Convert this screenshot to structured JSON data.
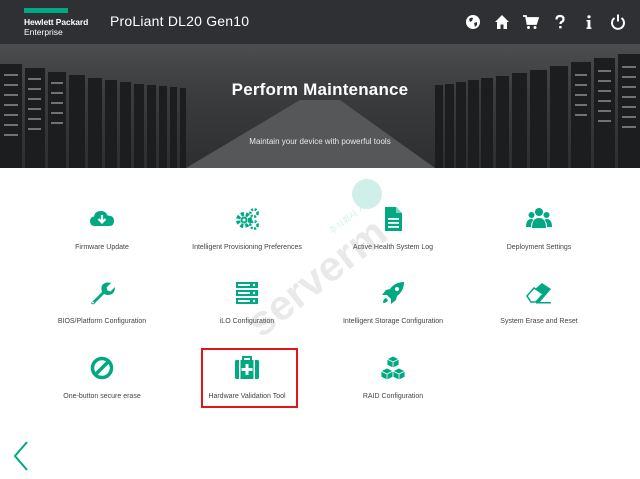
{
  "header": {
    "logo_line1": "Hewlett Packard",
    "logo_line2": "Enterprise",
    "product_title": "ProLiant DL20 Gen10",
    "icons": [
      "globe-icon",
      "home-icon",
      "cart-icon",
      "help-icon",
      "info-icon",
      "power-icon"
    ]
  },
  "hero": {
    "title": "Perform Maintenance",
    "subtitle": "Maintain your device with powerful tools"
  },
  "tiles": [
    {
      "label": "Firmware Update",
      "icon": "cloud-download-icon"
    },
    {
      "label": "Intelligent Provisioning Preferences",
      "icon": "gears-icon"
    },
    {
      "label": "Active Health System Log",
      "icon": "document-icon"
    },
    {
      "label": "Deployment Settings",
      "icon": "users-icon"
    },
    {
      "label": "BIOS/Platform Configuration",
      "icon": "wrench-icon"
    },
    {
      "label": "iLO Configuration",
      "icon": "server-icon"
    },
    {
      "label": "Intelligent Storage Configuration",
      "icon": "rocket-icon"
    },
    {
      "label": "System Erase and Reset",
      "icon": "eraser-icon"
    },
    {
      "label": "One-button secure erase",
      "icon": "ban-icon"
    },
    {
      "label": "Hardware Validation Tool",
      "icon": "medical-kit-icon"
    },
    {
      "label": "RAID Configuration",
      "icon": "cubes-icon"
    }
  ],
  "watermark": {
    "text": "serverm",
    "subtext": "주식회사 서버몬"
  },
  "colors": {
    "accent": "#01a982",
    "topbar": "#2e3033",
    "highlight": "#e2151a"
  }
}
